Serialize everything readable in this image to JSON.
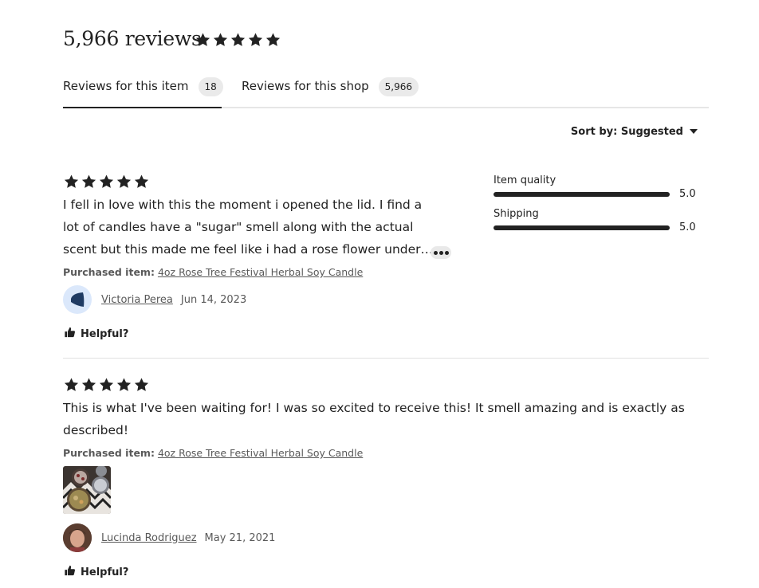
{
  "header": {
    "title": "5,966 reviews",
    "rating_stars": 5
  },
  "tabs": [
    {
      "label": "Reviews for this item",
      "count": "18",
      "active": true
    },
    {
      "label": "Reviews for this shop",
      "count": "5,966",
      "active": false
    }
  ],
  "sort": {
    "label": "Sort by: Suggested"
  },
  "ratings": [
    {
      "label": "Item quality",
      "value": "5.0"
    },
    {
      "label": "Shipping",
      "value": "5.0"
    }
  ],
  "reviews": [
    {
      "stars": 5,
      "lines": [
        "I fell in love with this the moment i opened the lid. I find a",
        "lot of candles have a \"sugar\" smell along with the actual",
        "scent but this made me feel like i had a rose flower under…"
      ],
      "purchased_label": "Purchased item:",
      "purchased_item": "4oz Rose Tree Festival Herbal Soy Candle",
      "reviewer": "Victoria Perea",
      "date": "Jun 14, 2023",
      "helpful": "Helpful?"
    },
    {
      "stars": 5,
      "lines": [
        "This is what I've been waiting for! I was so excited to receive this! It smell amazing and is exactly as",
        "described!"
      ],
      "purchased_label": "Purchased item:",
      "purchased_item": "4oz Rose Tree Festival Herbal Soy Candle",
      "reviewer": "Lucinda Rodriguez",
      "date": "May 21, 2021",
      "helpful": "Helpful?"
    }
  ],
  "colors": {
    "text": "#222222",
    "muted": "#595959",
    "badge": "#eaeaea",
    "avatar_bg": "#dbe8fb",
    "avatar_shape": "#1f3b63"
  }
}
